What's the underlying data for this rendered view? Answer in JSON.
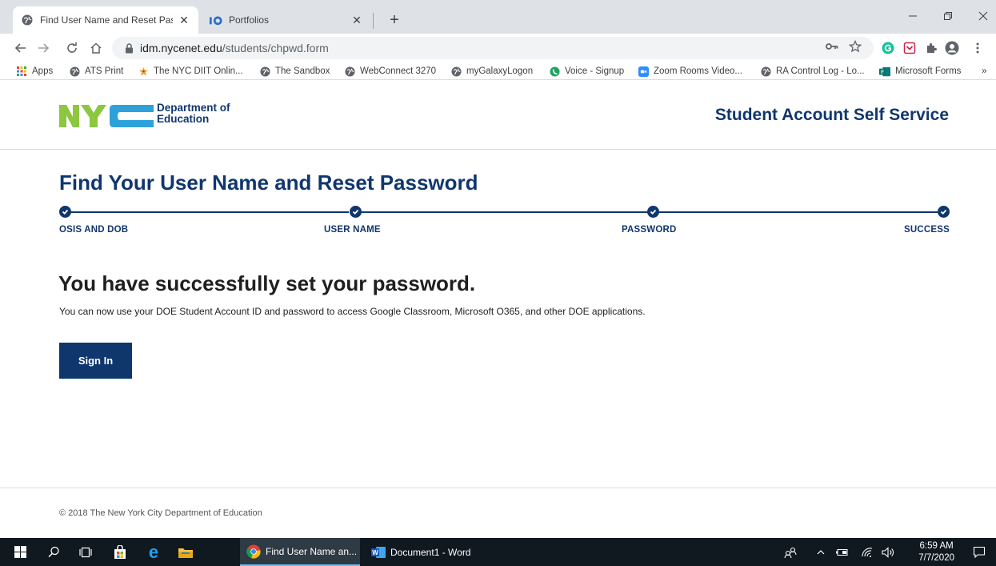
{
  "browser": {
    "tabs": [
      {
        "label": "Find User Name and Reset Passw",
        "active": true
      },
      {
        "label": "Portfolios",
        "active": false
      }
    ],
    "url_host": "idm.nycenet.edu",
    "url_path": "/students/chpwd.form",
    "bookmarks": [
      {
        "label": "Apps",
        "icon": "apps-grid-icon"
      },
      {
        "label": "ATS Print",
        "icon": "globe-icon"
      },
      {
        "label": "The NYC DIIT Onlin...",
        "icon": "star-person-icon"
      },
      {
        "label": "The Sandbox",
        "icon": "globe-icon"
      },
      {
        "label": "WebConnect 3270",
        "icon": "globe-icon"
      },
      {
        "label": "myGalaxyLogon",
        "icon": "globe-icon"
      },
      {
        "label": "Voice - Signup",
        "icon": "voice-icon"
      },
      {
        "label": "Zoom Rooms Video...",
        "icon": "zoom-icon"
      },
      {
        "label": "RA Control Log - Lo...",
        "icon": "globe-icon"
      },
      {
        "label": "Microsoft Forms",
        "icon": "forms-icon"
      }
    ],
    "bookmarks_overflow": "»"
  },
  "header": {
    "logo_line1": "Department of",
    "logo_line2": "Education",
    "service_title": "Student Account Self Service"
  },
  "main": {
    "title": "Find Your User Name and Reset Password",
    "steps": [
      "OSIS AND DOB",
      "USER NAME",
      "PASSWORD",
      "SUCCESS"
    ],
    "success_heading": "You have successfully set your password.",
    "success_desc": "You can now use your DOE Student Account ID and password to access Google Classroom, Microsoft O365, and other DOE applications.",
    "signin_label": "Sign In"
  },
  "footer": {
    "copyright": "© 2018 The New York City Department of Education"
  },
  "taskbar": {
    "apps": [
      {
        "label": "Find User Name an...",
        "icon": "chrome-icon",
        "active": true
      },
      {
        "label": "Document1 - Word",
        "icon": "word-icon",
        "active": false
      }
    ],
    "time": "6:59 AM",
    "date": "7/7/2020"
  },
  "colors": {
    "brand_navy": "#10366e",
    "nyc_green": "#8dc63f",
    "nyc_blue": "#2da1d9"
  }
}
